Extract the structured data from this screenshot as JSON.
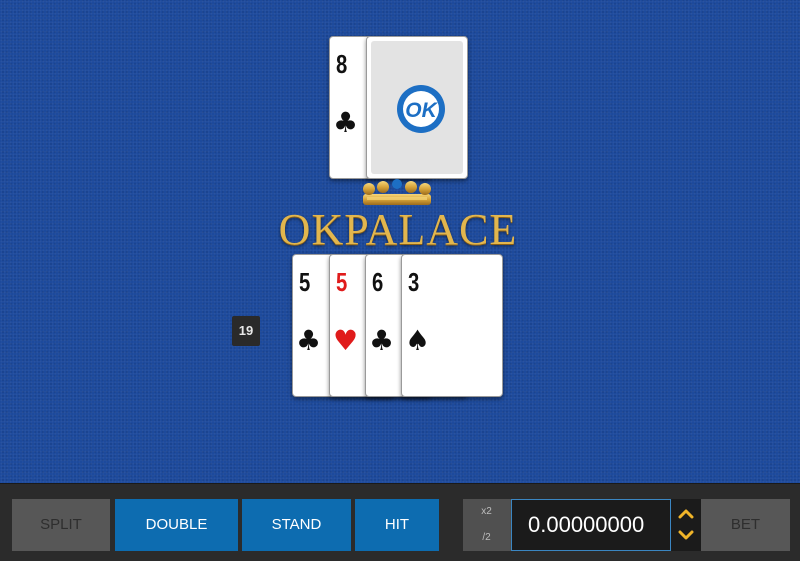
{
  "dealer": {
    "up_card": {
      "rank": "8",
      "suit": "♣",
      "color": "black"
    },
    "hole_card": {
      "face": "down",
      "logo_text": "OK"
    }
  },
  "brand": {
    "name": "OKPALACE"
  },
  "player": {
    "score": "19",
    "cards": [
      {
        "rank": "5",
        "suit": "♣",
        "color": "black"
      },
      {
        "rank": "5",
        "suit": "♥",
        "color": "red"
      },
      {
        "rank": "6",
        "suit": "♣",
        "color": "black"
      },
      {
        "rank": "3",
        "suit": "♠",
        "color": "black"
      }
    ]
  },
  "controls": {
    "split_label": "SPLIT",
    "double_label": "DOUBLE",
    "stand_label": "STAND",
    "hit_label": "HIT",
    "double_bet_label": "x2",
    "half_bet_label": "/2",
    "bet_amount": "0.00000000",
    "bet_label": "BET"
  },
  "colors": {
    "felt": "#1d4a9c",
    "action_blue": "#0d6cb0",
    "disabled": "#575757",
    "gold": "#e2b64e",
    "logo_blue": "#1d6fc4",
    "heart_red": "#e01b1b"
  }
}
